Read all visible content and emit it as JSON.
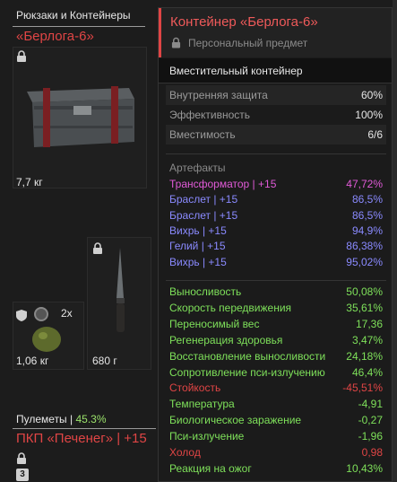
{
  "colors": {
    "accent_red": "#e04545",
    "pink": "#e05ad7",
    "blue": "#8a8aff",
    "green": "#7ee05a",
    "red": "#e04545"
  },
  "inventory": {
    "category_title": "Рюкзаки и Контейнеры",
    "container_name": "«Берлога-6»",
    "container_weight": "7,7 кг",
    "grenade_count": "2x",
    "grenade_weight": "1,06 кг",
    "knife_weight": "680 г",
    "machineguns_label": "Пулеметы",
    "machineguns_sep": " | ",
    "machineguns_pct": "45.3%",
    "mg_name": "ПКП «Печенег» | +15",
    "mg_badge": "3"
  },
  "tooltip": {
    "title": "Контейнер «Берлога-6»",
    "subtitle": "Персональный предмет",
    "type": "Вместительный контейнер",
    "params": [
      {
        "label": "Внутренняя защита",
        "value": "60%"
      },
      {
        "label": "Эффективность",
        "value": "100%"
      },
      {
        "label": "Вместимость",
        "value": "6/6"
      }
    ],
    "artifacts_title": "Артефакты",
    "artifacts": [
      {
        "label": "Трансформатор | +15",
        "value": "47,72%",
        "color": "#e05ad7"
      },
      {
        "label": "Браслет | +15",
        "value": "86,5%",
        "color": "#8a8aff"
      },
      {
        "label": "Браслет | +15",
        "value": "86,5%",
        "color": "#8a8aff"
      },
      {
        "label": "Вихрь | +15",
        "value": "94,9%",
        "color": "#8a8aff"
      },
      {
        "label": "Гелий | +15",
        "value": "86,38%",
        "color": "#8a8aff"
      },
      {
        "label": "Вихрь | +15",
        "value": "95,02%",
        "color": "#8a8aff"
      }
    ],
    "stats": [
      {
        "label": "Выносливость",
        "value": "50,08%",
        "color": "#7ee05a"
      },
      {
        "label": "Скорость передвижения",
        "value": "35,61%",
        "color": "#7ee05a"
      },
      {
        "label": "Переносимый вес",
        "value": "17,36",
        "color": "#7ee05a"
      },
      {
        "label": "Регенерация здоровья",
        "value": "3,47%",
        "color": "#7ee05a"
      },
      {
        "label": "Восстановление выносливости",
        "value": "24,18%",
        "color": "#7ee05a"
      },
      {
        "label": "Сопротивление пси-излучению",
        "value": "46,4%",
        "color": "#7ee05a"
      },
      {
        "label": "Стойкость",
        "value": "-45,51%",
        "color": "#e04545"
      },
      {
        "label": "Температура",
        "value": "-4,91",
        "color": "#7ee05a"
      },
      {
        "label": "Биологическое заражение",
        "value": "-0,27",
        "color": "#7ee05a"
      },
      {
        "label": "Пси-излучение",
        "value": "-1,96",
        "color": "#7ee05a"
      },
      {
        "label": "Холод",
        "value": "0,98",
        "color": "#e04545"
      },
      {
        "label": "Реакция на ожог",
        "value": "10,43%",
        "color": "#7ee05a"
      }
    ]
  }
}
